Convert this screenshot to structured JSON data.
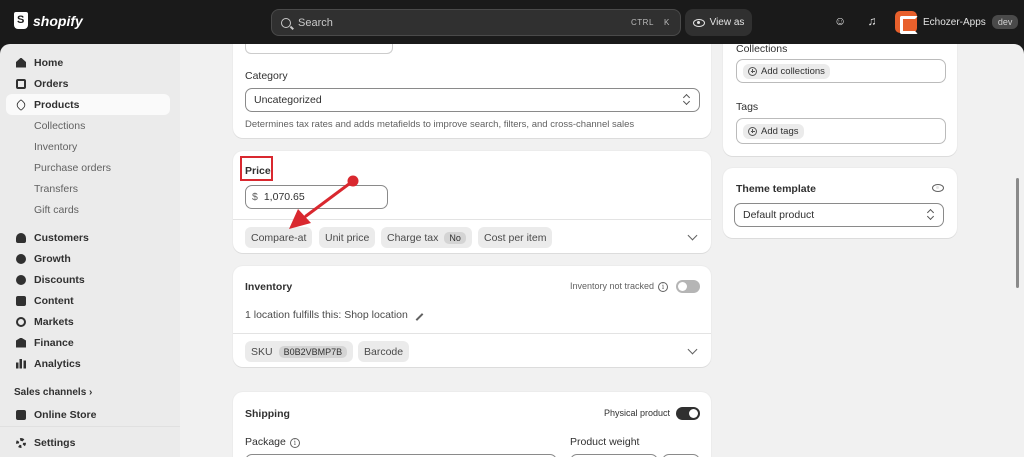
{
  "topbar": {
    "brand": "shopify",
    "search_placeholder": "Search",
    "shortcut_ctrl": "CTRL",
    "shortcut_k": "K",
    "view_as": "View as",
    "store_name": "Echozer-Apps",
    "store_badge": "dev"
  },
  "sidebar": {
    "items": [
      {
        "label": "Home",
        "icon": "home-icon"
      },
      {
        "label": "Orders",
        "icon": "orders-icon"
      },
      {
        "label": "Products",
        "icon": "tag-icon",
        "active": true
      },
      {
        "label": "Collections",
        "sub": true
      },
      {
        "label": "Inventory",
        "sub": true
      },
      {
        "label": "Purchase orders",
        "sub": true
      },
      {
        "label": "Transfers",
        "sub": true
      },
      {
        "label": "Gift cards",
        "sub": true
      },
      {
        "label": "Customers",
        "icon": "person-icon"
      },
      {
        "label": "Growth",
        "icon": "growth-icon"
      },
      {
        "label": "Discounts",
        "icon": "discount-icon"
      },
      {
        "label": "Content",
        "icon": "content-icon"
      },
      {
        "label": "Markets",
        "icon": "globe-icon"
      },
      {
        "label": "Finance",
        "icon": "bank-icon"
      },
      {
        "label": "Analytics",
        "icon": "bar-chart-icon"
      }
    ],
    "sales_channels": "Sales channels",
    "sales_channels_chevron": "›",
    "online_store": "Online Store",
    "settings": "Settings"
  },
  "category": {
    "label": "Category",
    "value": "Uncategorized",
    "help": "Determines tax rates and adds metafields to improve search, filters, and cross-channel sales"
  },
  "price": {
    "label": "Price",
    "currency": "$",
    "value": "1,070.65",
    "pills": [
      "Compare-at",
      "Unit price",
      "Charge tax",
      "Cost per item"
    ],
    "charge_tax_value": "No"
  },
  "inventory": {
    "label": "Inventory",
    "not_tracked": "Inventory not tracked",
    "fulfills": "1 location fulfills this: Shop location",
    "sku_label": "SKU",
    "sku_value": "B0B2VBMP7B",
    "barcode": "Barcode"
  },
  "shipping": {
    "label": "Shipping",
    "physical": "Physical product",
    "package": "Package",
    "weight": "Product weight"
  },
  "right": {
    "collections_label": "Collections",
    "add_collections": "Add collections",
    "tags_label": "Tags",
    "add_tags": "Add tags",
    "theme_label": "Theme template",
    "theme_value": "Default product"
  },
  "colors": {
    "annotation_red": "#d9282f",
    "topbar": "#1a1a1a",
    "sidebar": "#ebebeb",
    "main_bg": "#f1f1f1"
  }
}
